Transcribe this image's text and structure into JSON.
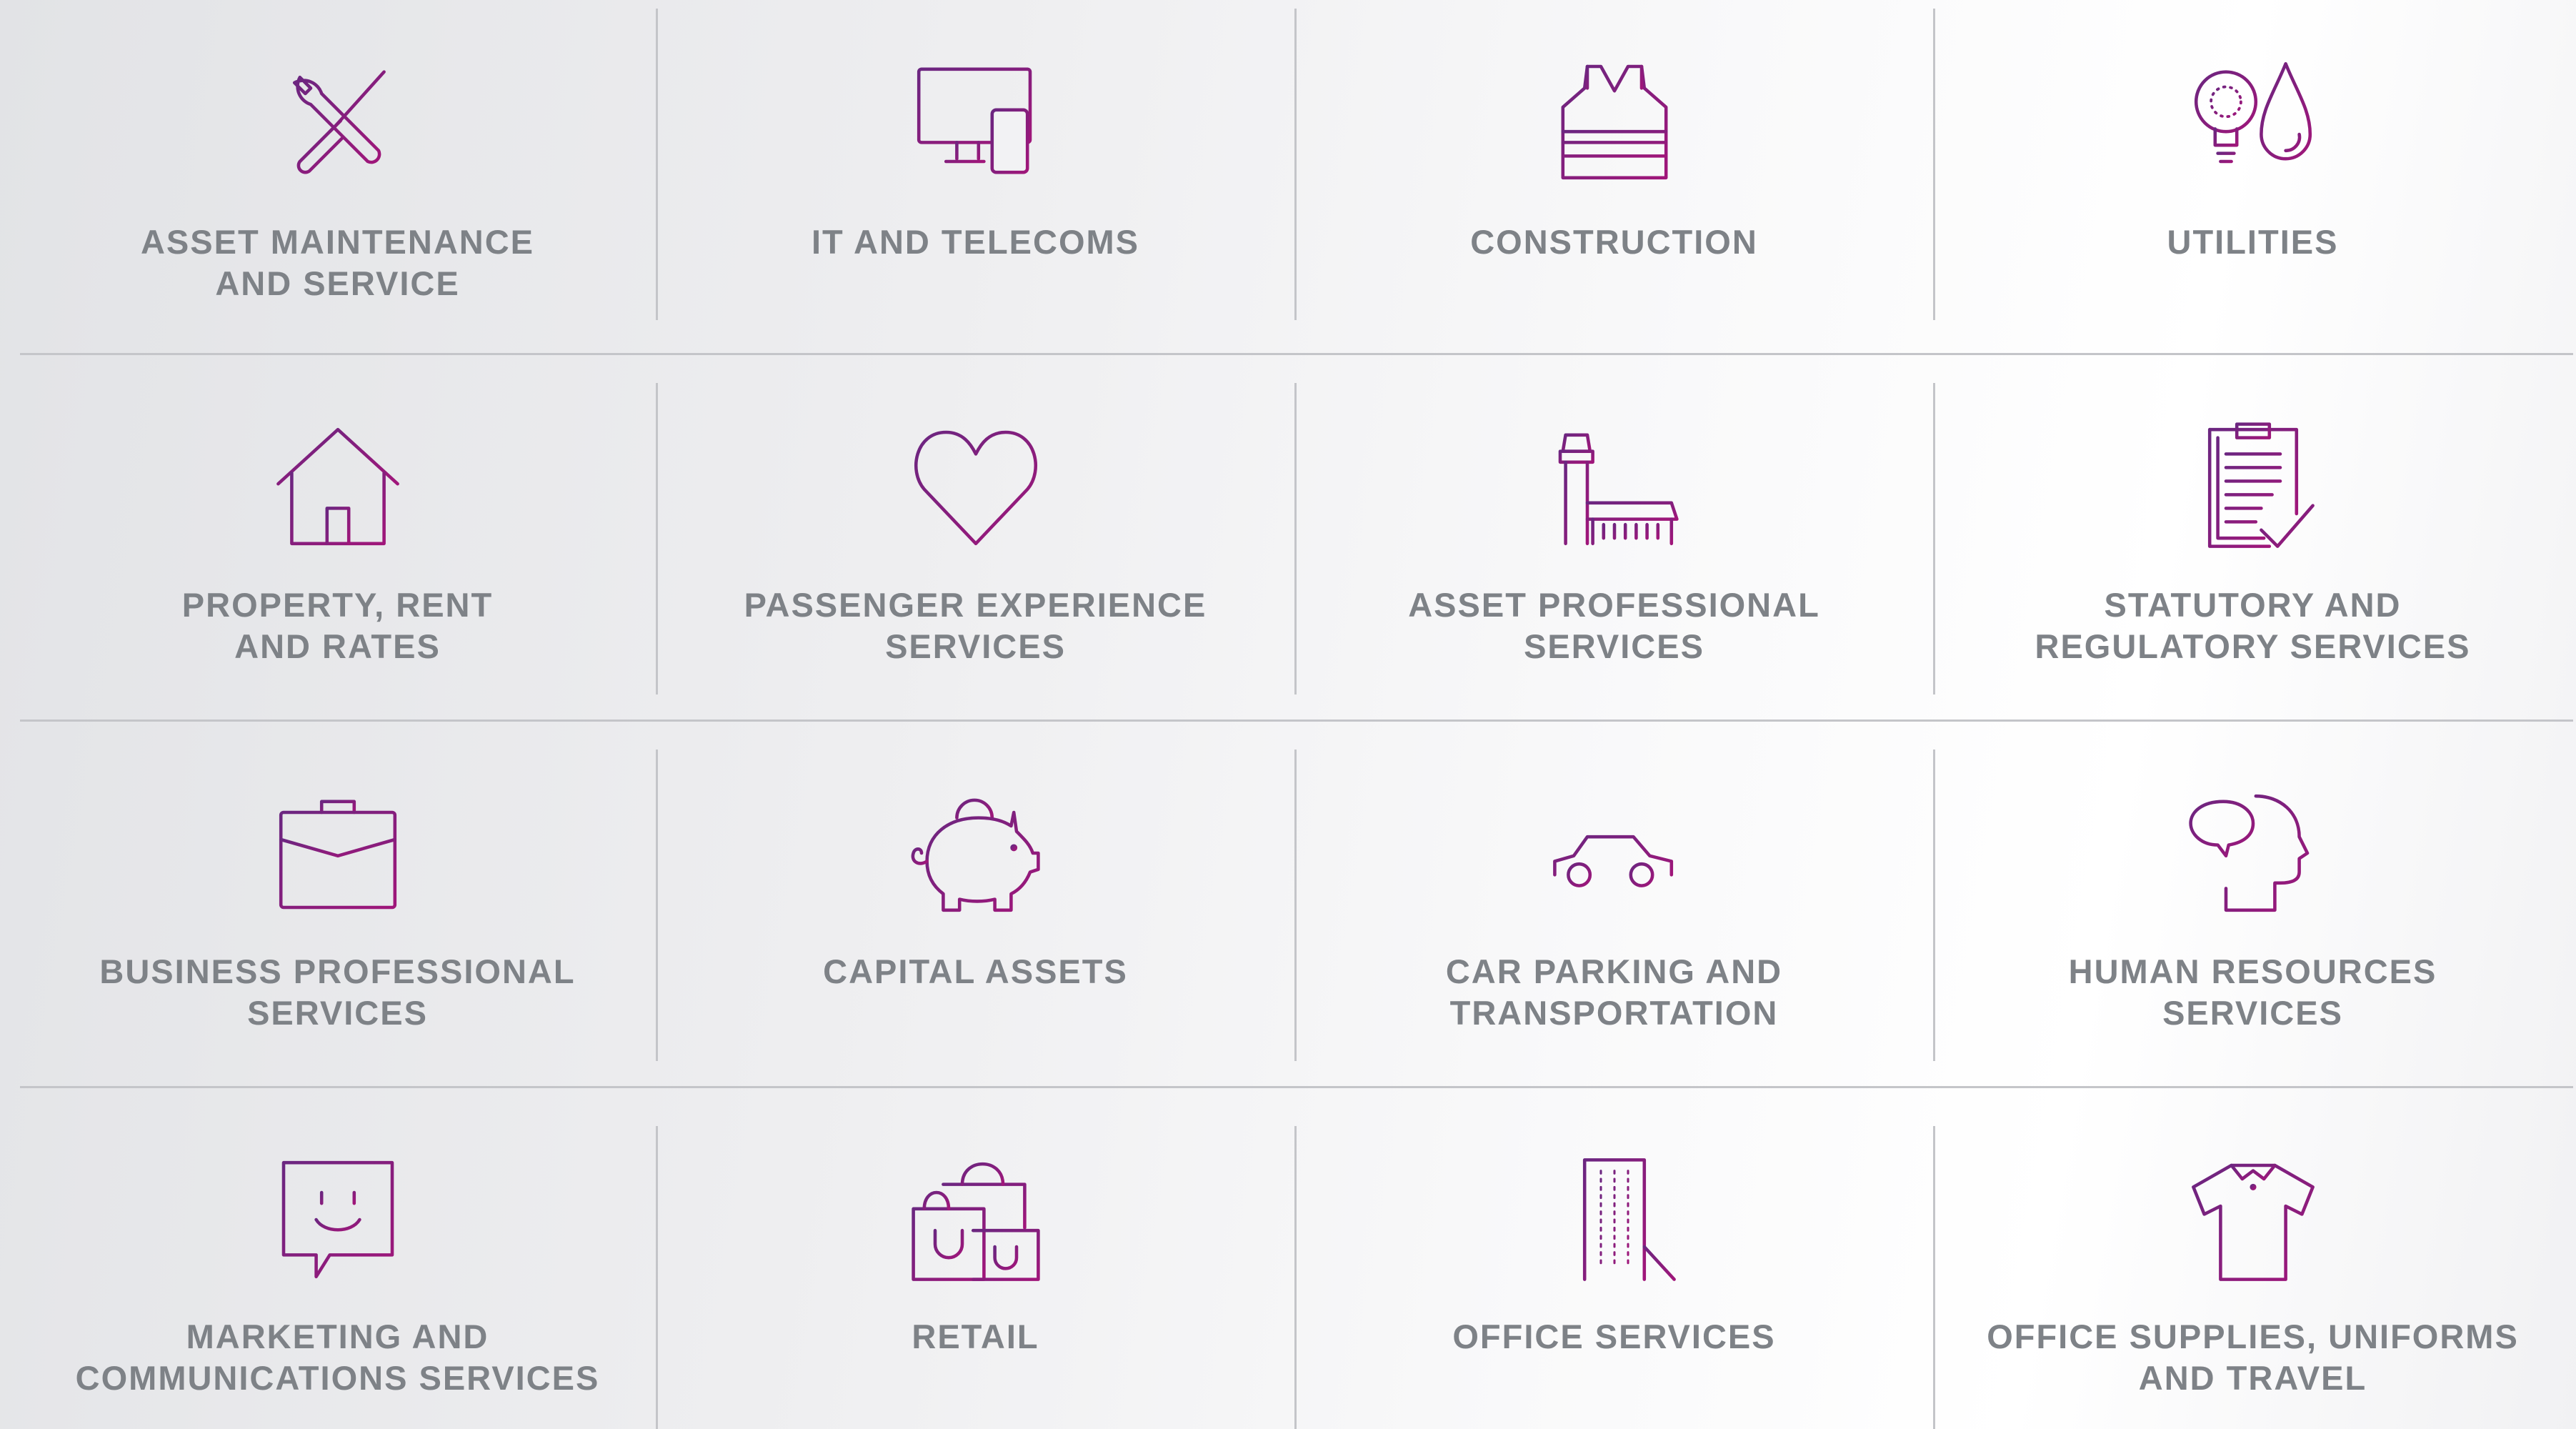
{
  "colors": {
    "icon_gradient_start": "#6b2680",
    "icon_gradient_end": "#a0167a",
    "label": "#7e8287",
    "divider": "#c4c5c9"
  },
  "rows": [
    {
      "cells": [
        {
          "icon": "wrench-screwdriver-icon",
          "label": "ASSET MAINTENANCE\nAND SERVICE"
        },
        {
          "icon": "monitor-tablet-icon",
          "label": "IT AND TELECOMS"
        },
        {
          "icon": "safety-vest-icon",
          "label": "CONSTRUCTION"
        },
        {
          "icon": "bulb-drop-icon",
          "label": "UTILITIES"
        }
      ]
    },
    {
      "cells": [
        {
          "icon": "house-icon",
          "label": "PROPERTY, RENT\nAND RATES"
        },
        {
          "icon": "heart-icon",
          "label": "PASSENGER EXPERIENCE\nSERVICES"
        },
        {
          "icon": "airport-tower-icon",
          "label": "ASSET PROFESSIONAL\nSERVICES"
        },
        {
          "icon": "clipboard-check-icon",
          "label": "STATUTORY AND\nREGULATORY SERVICES"
        }
      ]
    },
    {
      "cells": [
        {
          "icon": "briefcase-icon",
          "label": "BUSINESS PROFESSIONAL\nSERVICES"
        },
        {
          "icon": "piggy-bank-icon",
          "label": "CAPITAL ASSETS"
        },
        {
          "icon": "car-icon",
          "label": "CAR PARKING AND\nTRANSPORTATION"
        },
        {
          "icon": "head-speech-bubble-icon",
          "label": "HUMAN RESOURCES\nSERVICES"
        }
      ]
    },
    {
      "cells": [
        {
          "icon": "smiley-chat-icon",
          "label": "MARKETING AND\nCOMMUNICATIONS SERVICES"
        },
        {
          "icon": "shopping-bags-icon",
          "label": "RETAIL"
        },
        {
          "icon": "office-building-icon",
          "label": "OFFICE SERVICES"
        },
        {
          "icon": "polo-shirt-icon",
          "label": "OFFICE SUPPLIES, UNIFORMS\nAND TRAVEL"
        }
      ]
    }
  ]
}
